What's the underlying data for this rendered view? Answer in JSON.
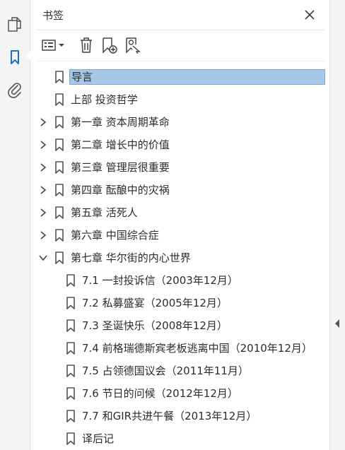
{
  "panel": {
    "title": "书签"
  },
  "bookmarks": [
    {
      "label": "导言",
      "level": 0,
      "expander": "none",
      "selected": true
    },
    {
      "label": "上部  投资哲学",
      "level": 0,
      "expander": "none"
    },
    {
      "label": "第一章  资本周期革命",
      "level": 0,
      "expander": "collapsed"
    },
    {
      "label": "第二章  增长中的价值",
      "level": 0,
      "expander": "collapsed"
    },
    {
      "label": "第三章  管理层很重要",
      "level": 0,
      "expander": "collapsed"
    },
    {
      "label": "第四章  酝酿中的灾祸",
      "level": 0,
      "expander": "collapsed"
    },
    {
      "label": "第五章  活死人",
      "level": 0,
      "expander": "collapsed"
    },
    {
      "label": "第六章  中国综合症",
      "level": 0,
      "expander": "collapsed"
    },
    {
      "label": "第七章  华尔街的内心世界",
      "level": 0,
      "expander": "expanded"
    },
    {
      "label": "7.1  一封投诉信（2003年12月）",
      "level": 1,
      "expander": "none"
    },
    {
      "label": "7.2  私募盛宴（2005年12月）",
      "level": 1,
      "expander": "none"
    },
    {
      "label": "7.3  圣诞快乐（2008年12月）",
      "level": 1,
      "expander": "none"
    },
    {
      "label": "7.4  前格瑞德斯宾老板逃离中国（2010年12月）",
      "level": 1,
      "expander": "none"
    },
    {
      "label": "7.5  占领德国议会（2011年11月）",
      "level": 1,
      "expander": "none"
    },
    {
      "label": "7.6  节日的问候（2012年12月）",
      "level": 1,
      "expander": "none"
    },
    {
      "label": "7.7  和GIR共进午餐（2013年12月）",
      "level": 1,
      "expander": "none"
    },
    {
      "label": "译后记",
      "level": 1,
      "expander": "none"
    }
  ],
  "icons": {
    "left_rail": [
      "pages-icon",
      "bookmarks-icon",
      "attachments-icon"
    ],
    "toolbar": [
      "options-menu-icon",
      "delete-bookmark-icon",
      "new-bookmark-icon",
      "new-bookmark-from-structure-icon"
    ],
    "close": "close-icon"
  },
  "colors": {
    "selection": "#a6c8e6",
    "accent": "#1d6fc1"
  }
}
